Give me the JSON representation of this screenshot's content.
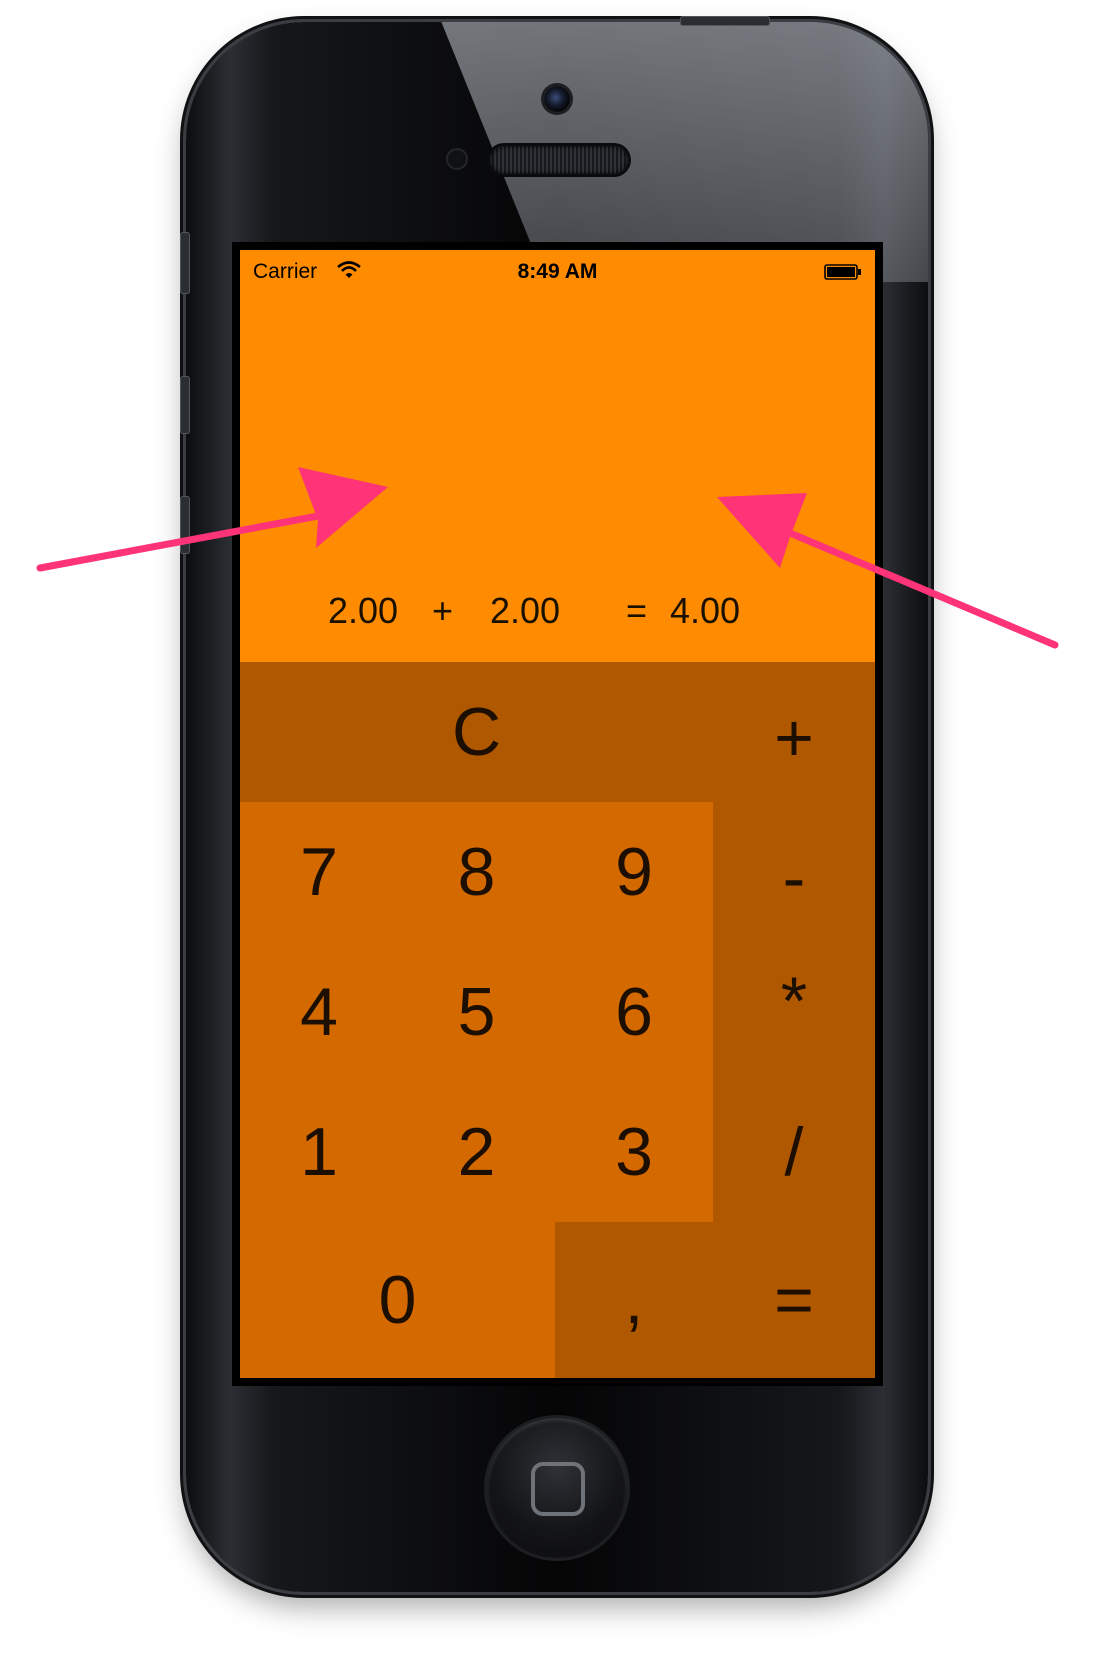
{
  "status_bar": {
    "carrier": "Carrier",
    "time": "8:49 AM"
  },
  "display": {
    "operand1": "2.00",
    "operator": "+",
    "operand2": "2.00",
    "equals": "=",
    "result": "4.00"
  },
  "keypad": {
    "clear": "C",
    "plus": "+",
    "minus": "-",
    "multiply": "*",
    "divide": "/",
    "equals": "=",
    "comma": ",",
    "seven": "7",
    "eight": "8",
    "nine": "9",
    "four": "4",
    "five": "5",
    "six": "6",
    "one": "1",
    "two": "2",
    "three": "3",
    "zero": "0"
  },
  "colors": {
    "screen_background": "#ff8c00",
    "number_key": "#d46900",
    "function_key": "#b05800",
    "annotation_arrow": "#ff3377"
  },
  "icons": [
    "wifi-icon",
    "battery-icon",
    "home-button-icon"
  ]
}
